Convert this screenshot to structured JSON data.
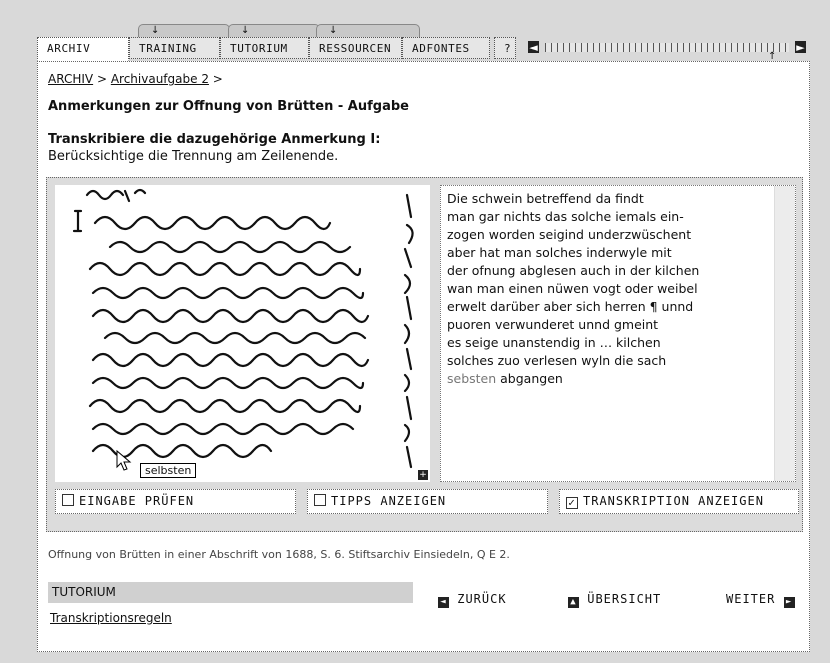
{
  "top_tabs": [
    "↓",
    "↓",
    "↓"
  ],
  "tabs": [
    {
      "label": "ARCHIV"
    },
    {
      "label": "TRAINING"
    },
    {
      "label": "TUTORIUM"
    },
    {
      "label": "RESSOURCEN"
    },
    {
      "label": "ADFONTES"
    },
    {
      "label": "?"
    }
  ],
  "timeline": {
    "left_arrow": "◄",
    "right_arrow": "►",
    "marker": "↑"
  },
  "breadcrumb": {
    "root": "ARCHIV",
    "sep1": ">",
    "item": "Archivaufgabe 2",
    "sep2": ">"
  },
  "page_title": "Anmerkungen zur Offnung von Brütten - Aufgabe",
  "task": {
    "heading": "Transkribiere die dazugehörige Anmerkung I:",
    "subtext": "Berücksichtige die Trennung am Zeilenende."
  },
  "manuscript": {
    "tooltip": "selbsten",
    "zoom_icon": "+"
  },
  "transcription": {
    "lines": [
      "Die schwein betreffend da findt",
      "man gar nichts das solche iemals ein-",
      "zogen worden seigind underzwüschent",
      "aber hat man solches inderwyle mit",
      "der ofnung abglesen auch in der kilchen",
      "wan man einen nüwen vogt oder weibel",
      "erwelt darüber aber sich herren ¶ unnd",
      "puoren verwunderet unnd gmeint",
      "es seige unanstendig in … kilchen",
      "solches zuo verlesen wyln die sach"
    ],
    "last_line_highlight": "sebsten",
    "last_line_rest": " abgangen"
  },
  "buttons": {
    "check": "EINGABE PRÜFEN",
    "tips": "TIPPS ANZEIGEN",
    "show_transcription": "TRANSKRIPTION ANZEIGEN",
    "show_transcription_checked": true
  },
  "caption": "Offnung von Brütten in einer Abschrift von 1688, S. 6. Stiftsarchiv Einsiedeln, Q E 2.",
  "tutorium": {
    "heading": "TUTORIUM",
    "link": "Transkriptionsregeln"
  },
  "nav": {
    "back": "ZURÜCK",
    "overview": "ÜBERSICHT",
    "next": "WEITER"
  }
}
